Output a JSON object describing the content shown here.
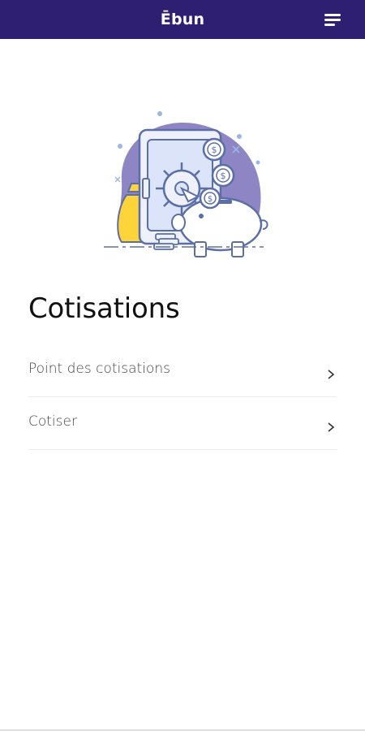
{
  "app_bar": {
    "title": "Ēbun",
    "menu_icon": "menu-icon",
    "background": "#2f1f73"
  },
  "illustration": {
    "icon": "safe-piggy-bank-coins-illustration",
    "colors": {
      "blob": "#8e86c4",
      "safe": "#eef1fb",
      "outline": "#5b6ea6",
      "money_bag": "#ffd43b"
    }
  },
  "main": {
    "title": "Cotisations",
    "items": [
      {
        "label": "Point des cotisations",
        "icon": "chevron-right-icon"
      },
      {
        "label": "Cotiser",
        "icon": "chevron-right-icon"
      }
    ]
  }
}
